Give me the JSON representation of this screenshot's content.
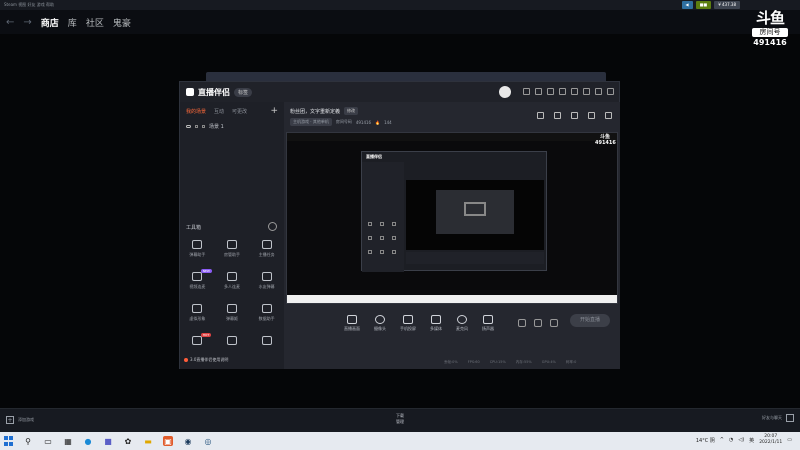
{
  "steam": {
    "top_left": "Steam  视图  好友  游戏  帮助",
    "top_chips": [
      "",
      "",
      ""
    ],
    "top_right_text": "¥ 437.38",
    "nav": [
      "商店",
      "库",
      "社区",
      "鬼豪"
    ]
  },
  "douyu": {
    "logo": "斗鱼",
    "room_label": "房间号",
    "room_number": "491416"
  },
  "live_app": {
    "title": "直播伴侣",
    "version": "标签",
    "tabs": [
      "我的场景",
      "互动",
      "可更改"
    ],
    "scene_name": "场景 1",
    "room_title": "粉丝团，文字重新定義",
    "edit_label": "修改",
    "category": "主机游戏 · 其他单机",
    "room_id_label": "房间号码",
    "room_id": "491416",
    "popularity": "144",
    "toolbox_title": "工具箱",
    "tools": [
      {
        "label": "弹幕助手",
        "badge": ""
      },
      {
        "label": "房管助手",
        "badge": ""
      },
      {
        "label": "主播任务",
        "badge": ""
      },
      {
        "label": "视频连麦",
        "badge": "NEW"
      },
      {
        "label": "多人连麦",
        "badge": ""
      },
      {
        "label": "水友弹幕",
        "badge": ""
      },
      {
        "label": "虚拟形象",
        "badge": ""
      },
      {
        "label": "弹幕姬",
        "badge": ""
      },
      {
        "label": "数据助手",
        "badge": ""
      },
      {
        "label": "",
        "badge": "HOT"
      },
      {
        "label": "",
        "badge": ""
      },
      {
        "label": "",
        "badge": ""
      }
    ],
    "notice": "3.0直播伴侣使用说明",
    "controls": [
      "直播画面",
      "摄像头",
      "手机投屏",
      "多媒体",
      "麦克风",
      "扬声器"
    ],
    "start_button": "开始直播",
    "status": [
      "丢帧:0%",
      "FPS:60",
      "CPU:15%",
      "内存:55%",
      "GPU:4%",
      "码率:0"
    ]
  },
  "steam_bottom": {
    "left_label": "添加游戏",
    "center_label": "下载",
    "center_sub": "管理",
    "right_label": "好友与聊天"
  },
  "taskbar": {
    "temperature": "14°C 阴",
    "time": "20:07",
    "date": "2022/1/11",
    "lang": "英"
  }
}
